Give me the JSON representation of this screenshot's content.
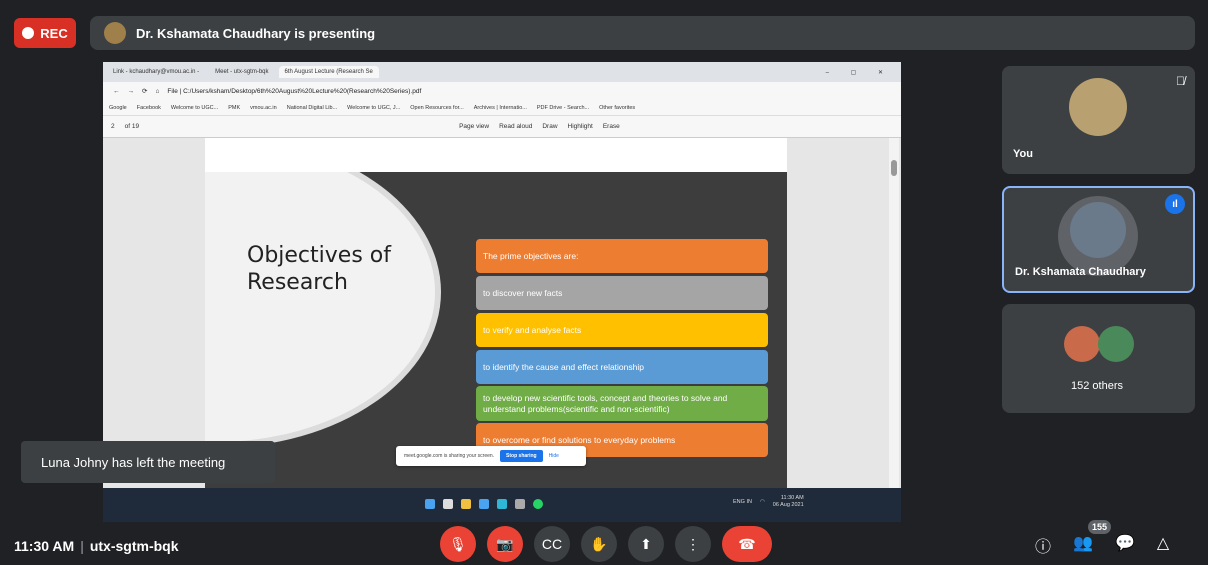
{
  "rec_label": "REC",
  "presenter_bar": {
    "text": "Dr. Kshamata Chaudhary is presenting"
  },
  "shared_screen": {
    "tabs": [
      "Link - kchaudhary@vmou.ac.in -",
      "Meet - utx-sgtm-bqk",
      "6th August Lecture (Research Se"
    ],
    "window_controls": "– ▢ ✕",
    "address": "File | C:/Users/ksham/Desktop/6th%20August%20Lecture%20(Research%20Series).pdf",
    "bookmarks": [
      "Google",
      "Facebook",
      "Welcome to UGC...",
      "PMK",
      "vmou.ac.in",
      "National Digital Lib...",
      "Welcome to UGC, J...",
      "Open Resources for...",
      "Archives | Internatio...",
      "PDF Drive - Search...",
      "Other favorites"
    ],
    "pdf_toolbar": {
      "page": "2",
      "of_pages": "of 19",
      "page_view": "Page view",
      "read_aloud": "Read aloud",
      "draw": "Draw",
      "highlight": "Highlight",
      "erase": "Erase"
    },
    "slide": {
      "title": "Objectives of\nResearch",
      "boxes": [
        {
          "text": "The prime objectives are:",
          "color": "#ed7d31"
        },
        {
          "text": "to discover new facts",
          "color": "#a5a5a5"
        },
        {
          "text": "to verify and analyse facts",
          "color": "#ffc000"
        },
        {
          "text": "to identify the cause and effect relationship",
          "color": "#5b9bd5"
        },
        {
          "text": "to develop new scientific tools, concept and theories to solve and understand problems(scientific and non-scientific)",
          "color": "#70ad47"
        },
        {
          "text": "to overcome or find solutions to everyday problems",
          "color": "#ed7d31"
        }
      ]
    },
    "sharing_notice": {
      "text": "meet.google.com is sharing your screen.",
      "stop": "Stop sharing",
      "hide": "Hide"
    },
    "tray": {
      "lang": "ENG\nIN",
      "time": "11:30 AM",
      "date": "06 Aug 2021"
    }
  },
  "toast": "Luna Johny has left the meeting",
  "participants": [
    {
      "name": "You",
      "muted": true
    },
    {
      "name": "Dr. Kshamata Chaudhary",
      "speaking": true
    },
    {
      "name": "152 others"
    }
  ],
  "bottom": {
    "time": "11:30 AM",
    "meeting_code": "utx-sgtm-bqk",
    "participant_count": "155"
  },
  "icons": {
    "mic_off": "mic-off-icon",
    "cam_off": "camera-off-icon",
    "captions": "captions-icon",
    "raise_hand": "raise-hand-icon",
    "present": "present-icon",
    "more": "more-vert-icon",
    "end_call": "end-call-icon",
    "info": "info-icon",
    "people": "people-icon",
    "chat": "chat-icon",
    "activities": "activities-icon"
  }
}
